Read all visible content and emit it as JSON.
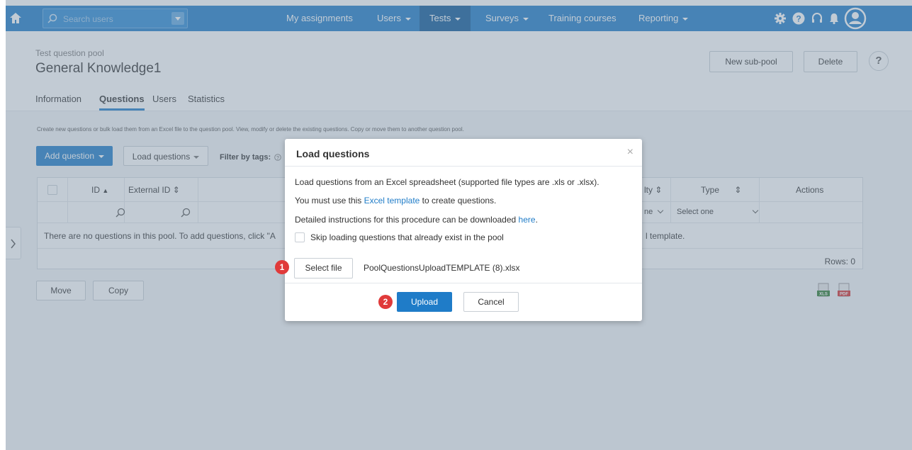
{
  "topnav": {
    "search_placeholder": "Search users",
    "items": [
      "My assignments",
      "Users",
      "Tests",
      "Surveys",
      "Training courses",
      "Reporting"
    ]
  },
  "page": {
    "breadcrumb": "Test question pool",
    "title": "General Knowledge1",
    "buttons": {
      "new_sub_pool": "New sub-pool",
      "delete": "Delete",
      "help": "?"
    },
    "tabs": [
      "Information",
      "Questions",
      "Users",
      "Statistics"
    ],
    "intro": "Create new questions or bulk load them from an Excel file to the question pool. View, modify or delete the existing questions. Copy or move them to another question pool.",
    "add_question": "Add question",
    "load_questions": "Load questions",
    "filter_by_tags": "Filter by tags:"
  },
  "table": {
    "headers": {
      "id": "ID",
      "external_id": "External ID",
      "difficulty_partial": "lty",
      "type": "Type",
      "actions": "Actions"
    },
    "filters": {
      "difficulty_partial": "ne",
      "type_select": "Select one"
    },
    "empty_left": "There are no questions in this pool. To add questions, click \"A",
    "empty_right": "l template.",
    "rows_footer": "Rows: 0"
  },
  "bottom_buttons": {
    "move": "Move",
    "copy": "Copy"
  },
  "export_icons": {
    "xls": "XLS",
    "pdf": "PDF"
  },
  "modal": {
    "title": "Load questions",
    "close": "×",
    "line1": "Load questions from an Excel spreadsheet (supported file types are .xls or .xlsx).",
    "line2_pre": "You must use this ",
    "line2_link": "Excel template",
    "line2_post": " to create questions.",
    "line3_pre": "Detailed instructions for this procedure can be downloaded ",
    "line3_link": "here",
    "line3_post": ".",
    "skip_label": "Skip loading questions that already exist in the pool",
    "select_file": "Select file",
    "file_name": "PoolQuestionsUploadTEMPLATE (8).xlsx",
    "upload": "Upload",
    "cancel": "Cancel",
    "badge1": "1",
    "badge2": "2"
  },
  "colors": {
    "primary": "#1f7cc8",
    "nav_active": "#0f5a99",
    "badge": "#e03a3a"
  }
}
